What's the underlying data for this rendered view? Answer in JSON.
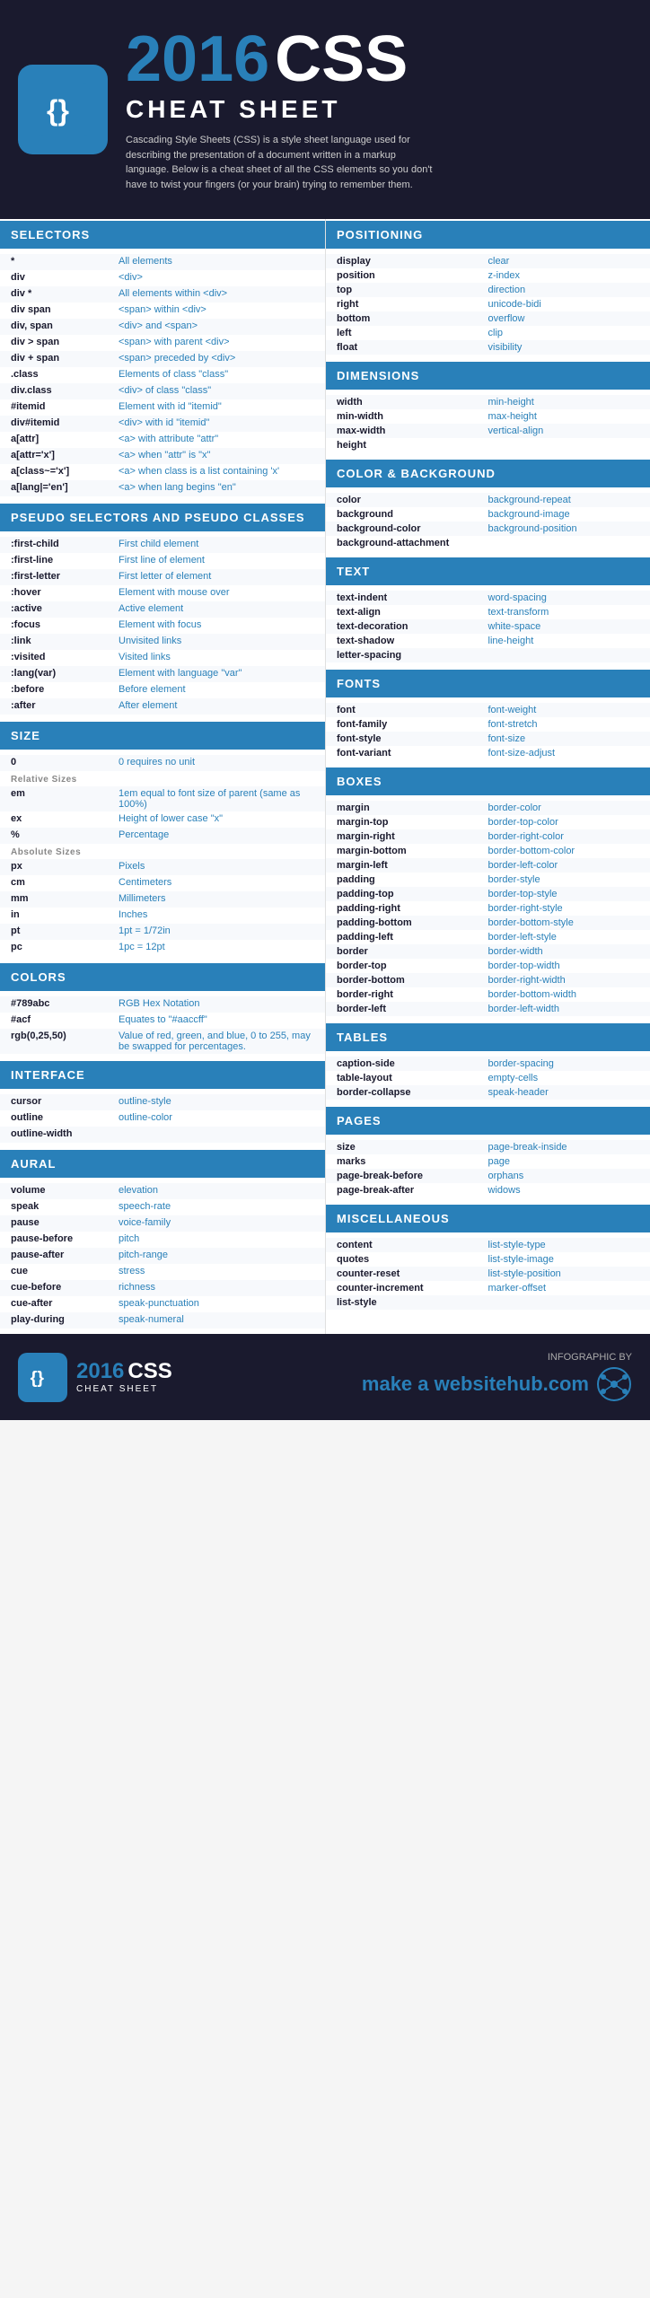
{
  "header": {
    "year": "2016",
    "css": "CSS",
    "cheat": "CHEAT SHEET",
    "description": "Cascading Style Sheets (CSS) is a style sheet language used for describing the presentation of a document written in a markup language. Below is a cheat sheet of all the CSS elements so you don't have to twist your fingers (or your brain) trying to remember them."
  },
  "selectors": {
    "header": "SELECTORS",
    "rows": [
      {
        "key": "*",
        "value": "All elements"
      },
      {
        "key": "div",
        "value": "<div>"
      },
      {
        "key": "div *",
        "value": "All elements within <div>"
      },
      {
        "key": "div span",
        "value": "<span> within <div>"
      },
      {
        "key": "div, span",
        "value": "<div> and <span>"
      },
      {
        "key": "div > span",
        "value": "<span> with parent <div>"
      },
      {
        "key": "div + span",
        "value": "<span> preceded by <div>"
      },
      {
        "key": ".class",
        "value": "Elements of class \"class\""
      },
      {
        "key": "div.class",
        "value": "<div> of class \"class\""
      },
      {
        "key": "#itemid",
        "value": "Element with id \"itemid\""
      },
      {
        "key": "div#itemid",
        "value": "<div> with id \"itemid\""
      },
      {
        "key": "a[attr]",
        "value": "<a> with attribute \"attr\""
      },
      {
        "key": "a[attr='x']",
        "value": "<a> when \"attr\" is \"x\""
      },
      {
        "key": "a[class~='x']",
        "value": "<a> when class is a list containing 'x'"
      },
      {
        "key": "a[lang|='en']",
        "value": "<a> when lang begins \"en\""
      }
    ]
  },
  "pseudo": {
    "header": "PSEUDO SELECTORS AND PSEUDO CLASSES",
    "rows": [
      {
        "key": ":first-child",
        "value": "First child element"
      },
      {
        "key": ":first-line",
        "value": "First line of element"
      },
      {
        "key": ":first-letter",
        "value": "First letter of element"
      },
      {
        "key": ":hover",
        "value": "Element with mouse over"
      },
      {
        "key": ":active",
        "value": "Active element"
      },
      {
        "key": ":focus",
        "value": "Element with focus"
      },
      {
        "key": ":link",
        "value": "Unvisited links"
      },
      {
        "key": ":visited",
        "value": "Visited links"
      },
      {
        "key": ":lang(var)",
        "value": "Element with language \"var\""
      },
      {
        "key": ":before",
        "value": "Before element"
      },
      {
        "key": ":after",
        "value": "After element"
      }
    ]
  },
  "size": {
    "header": "SIZE",
    "rows": [
      {
        "key": "0",
        "value": "0 requires no unit",
        "note": ""
      },
      {
        "sublabel": "Relative Sizes"
      },
      {
        "key": "em",
        "value": "1em equal to font size of parent (same as 100%)"
      },
      {
        "key": "ex",
        "value": "Height of lower case \"x\""
      },
      {
        "key": "%",
        "value": "Percentage"
      },
      {
        "sublabel": "Absolute Sizes"
      },
      {
        "key": "px",
        "value": "Pixels"
      },
      {
        "key": "cm",
        "value": "Centimeters"
      },
      {
        "key": "mm",
        "value": "Millimeters"
      },
      {
        "key": "in",
        "value": "Inches"
      },
      {
        "key": "pt",
        "value": "1pt = 1/72in"
      },
      {
        "key": "pc",
        "value": "1pc = 12pt"
      }
    ]
  },
  "colors_section": {
    "header": "COLORS",
    "rows": [
      {
        "key": "#789abc",
        "value": "RGB Hex Notation"
      },
      {
        "key": "#acf",
        "value": "Equates to \"#aaccff\""
      },
      {
        "key": "rgb(0,25,50)",
        "value": "Value of red, green, and blue, 0 to 255, may be swapped for percentages."
      }
    ]
  },
  "interface": {
    "header": "INTERFACE",
    "rows": [
      {
        "key": "cursor",
        "value": "outline-style"
      },
      {
        "key": "outline",
        "value": "outline-color"
      },
      {
        "key": "outline-width",
        "value": ""
      }
    ]
  },
  "aural": {
    "header": "AURAL",
    "rows": [
      {
        "key": "volume",
        "value": "elevation"
      },
      {
        "key": "speak",
        "value": "speech-rate"
      },
      {
        "key": "pause",
        "value": "voice-family"
      },
      {
        "key": "pause-before",
        "value": "pitch"
      },
      {
        "key": "pause-after",
        "value": "pitch-range"
      },
      {
        "key": "cue",
        "value": "stress"
      },
      {
        "key": "cue-before",
        "value": "richness"
      },
      {
        "key": "cue-after",
        "value": "speak-punctuation"
      },
      {
        "key": "play-during",
        "value": "speak-numeral"
      }
    ]
  },
  "positioning": {
    "header": "POSITIONING",
    "rows": [
      {
        "left": "display",
        "right": "clear"
      },
      {
        "left": "position",
        "right": "z-index"
      },
      {
        "left": "top",
        "right": "direction"
      },
      {
        "left": "right",
        "right": "unicode-bidi"
      },
      {
        "left": "bottom",
        "right": "overflow"
      },
      {
        "left": "left",
        "right": "clip"
      },
      {
        "left": "float",
        "right": "visibility"
      }
    ]
  },
  "dimensions": {
    "header": "DIMENSIONS",
    "rows": [
      {
        "left": "width",
        "right": "min-height"
      },
      {
        "left": "min-width",
        "right": "max-height"
      },
      {
        "left": "max-width",
        "right": "vertical-align"
      },
      {
        "left": "height",
        "right": ""
      }
    ]
  },
  "color_bg": {
    "header": "COLOR & BACKGROUND",
    "rows": [
      {
        "left": "color",
        "right": "background-repeat"
      },
      {
        "left": "background",
        "right": "background-image"
      },
      {
        "left": "background-color",
        "right": "background-position"
      },
      {
        "left": "background-attachment",
        "right": ""
      }
    ]
  },
  "text": {
    "header": "TEXT",
    "rows": [
      {
        "left": "text-indent",
        "right": "word-spacing"
      },
      {
        "left": "text-align",
        "right": "text-transform"
      },
      {
        "left": "text-decoration",
        "right": "white-space"
      },
      {
        "left": "text-shadow",
        "right": "line-height"
      },
      {
        "left": "letter-spacing",
        "right": ""
      }
    ]
  },
  "fonts": {
    "header": "FONTS",
    "rows": [
      {
        "left": "font",
        "right": "font-weight"
      },
      {
        "left": "font-family",
        "right": "font-stretch"
      },
      {
        "left": "font-style",
        "right": "font-size"
      },
      {
        "left": "font-variant",
        "right": "font-size-adjust"
      }
    ]
  },
  "boxes": {
    "header": "BOXES",
    "rows": [
      {
        "left": "margin",
        "right": "border-color"
      },
      {
        "left": "margin-top",
        "right": "border-top-color"
      },
      {
        "left": "margin-right",
        "right": "border-right-color"
      },
      {
        "left": "margin-bottom",
        "right": "border-bottom-color"
      },
      {
        "left": "margin-left",
        "right": "border-left-color"
      },
      {
        "left": "padding",
        "right": "border-style"
      },
      {
        "left": "padding-top",
        "right": "border-top-style"
      },
      {
        "left": "padding-right",
        "right": "border-right-style"
      },
      {
        "left": "padding-bottom",
        "right": "border-bottom-style"
      },
      {
        "left": "padding-left",
        "right": "border-left-style"
      },
      {
        "left": "border",
        "right": "border-width"
      },
      {
        "left": "border-top",
        "right": "border-top-width"
      },
      {
        "left": "border-bottom",
        "right": "border-right-width"
      },
      {
        "left": "border-right",
        "right": "border-bottom-width"
      },
      {
        "left": "border-left",
        "right": "border-left-width"
      }
    ]
  },
  "tables": {
    "header": "TABLES",
    "rows": [
      {
        "left": "caption-side",
        "right": "border-spacing"
      },
      {
        "left": "table-layout",
        "right": "empty-cells"
      },
      {
        "left": "border-collapse",
        "right": "speak-header"
      }
    ]
  },
  "pages": {
    "header": "PAGES",
    "rows": [
      {
        "left": "size",
        "right": "page-break-inside"
      },
      {
        "left": "marks",
        "right": "page"
      },
      {
        "left": "page-break-before",
        "right": "orphans"
      },
      {
        "left": "page-break-after",
        "right": "widows"
      }
    ]
  },
  "miscellaneous": {
    "header": "MISCELLANEOUS",
    "rows": [
      {
        "left": "content",
        "right": "list-style-type"
      },
      {
        "left": "quotes",
        "right": "list-style-image"
      },
      {
        "left": "counter-reset",
        "right": "list-style-position"
      },
      {
        "left": "counter-increment",
        "right": "marker-offset"
      },
      {
        "left": "list-style",
        "right": ""
      }
    ]
  },
  "footer": {
    "infographic_by": "INFOGRAPHIC BY",
    "brand": "make a websitehub.com",
    "year": "2016",
    "css": "CSS",
    "cheat": "CHEAT SHEET"
  }
}
